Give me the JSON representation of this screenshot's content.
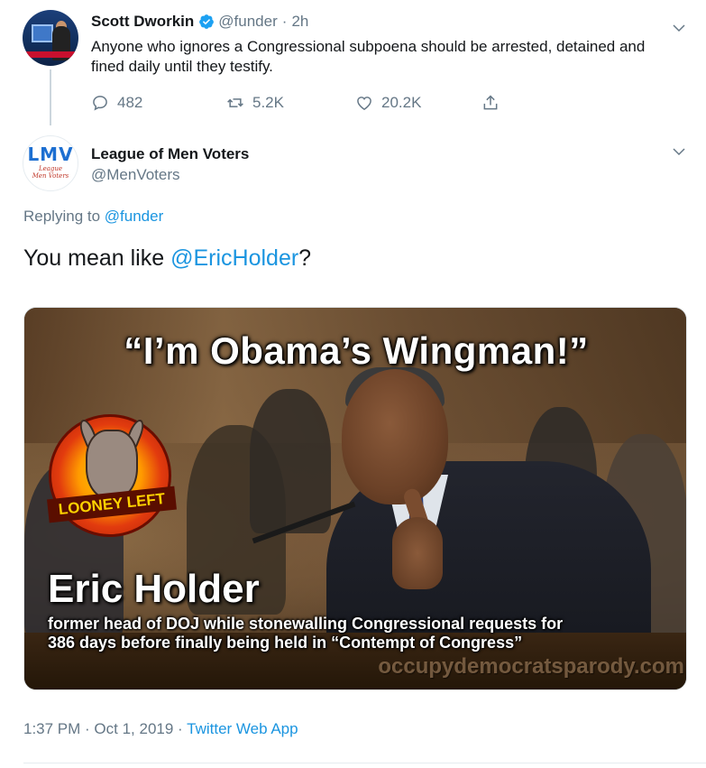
{
  "parent_tweet": {
    "display_name": "Scott Dworkin",
    "handle": "@funder",
    "separator": "·",
    "time": "2h",
    "text": "Anyone who ignores a Congressional subpoena should be arrested, detained and fined daily until they testify.",
    "verified": true,
    "icons": {
      "verified": "verified-badge-icon",
      "menu": "chevron-down-icon"
    },
    "actions": {
      "reply_count": "482",
      "retweet_count": "5.2K",
      "like_count": "20.2K"
    }
  },
  "reply_tweet": {
    "avatar_text": "LMV",
    "avatar_subtext_1": "League",
    "avatar_subtext_2": "Men Voters",
    "display_name": "League of Men Voters",
    "handle": "@MenVoters",
    "replying_prefix": "Replying to",
    "replying_to": "@funder",
    "text_prefix": "You mean like",
    "text_mention": "@EricHolder",
    "text_suffix": "?",
    "timestamp": "1:37 PM · Oct 1, 2019 ·",
    "source": "Twitter Web App"
  },
  "media": {
    "headline": "“I’m Obama’s Wingman!”",
    "logo_text": "LOONEY LEFT",
    "person_name": "Eric Holder",
    "caption_line_1": "former head of DOJ while stonewalling Congressional requests for",
    "caption_line_2": "386 days before finally being held in “Contempt of Congress”",
    "watermark": "occupydemocratsparody.com"
  },
  "colors": {
    "link": "#1b95e0",
    "muted": "#657786",
    "text": "#14171a",
    "verified": "#1da1f2"
  }
}
